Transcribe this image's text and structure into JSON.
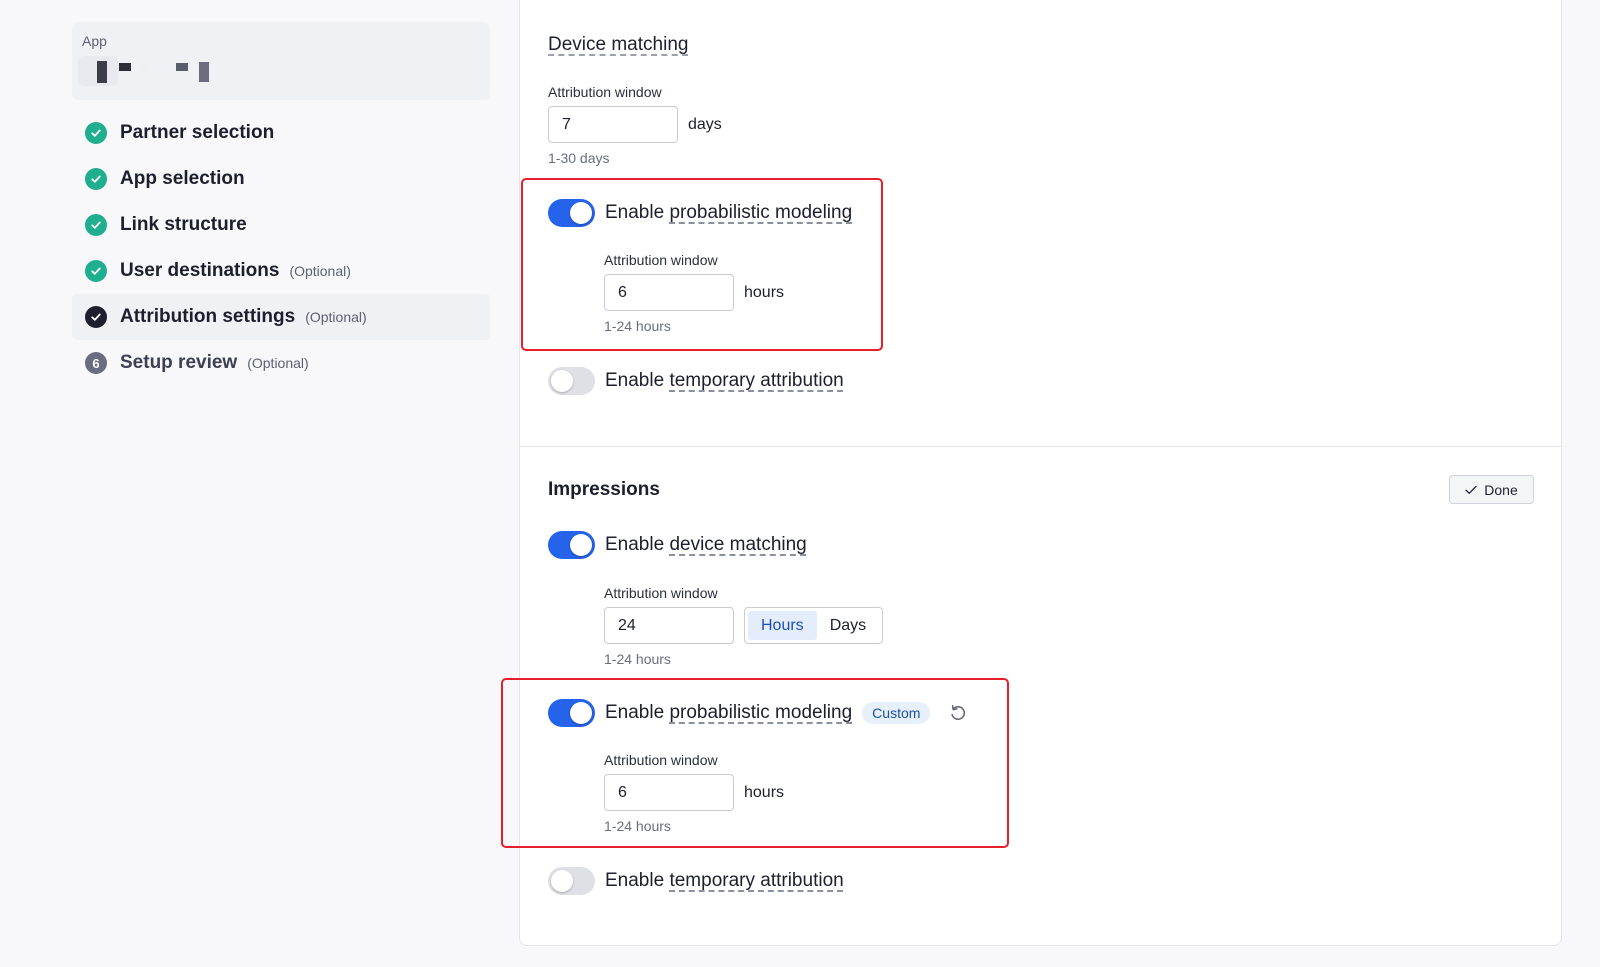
{
  "sidebar": {
    "app_label": "App",
    "steps": [
      {
        "label": "Partner selection",
        "optional": "",
        "status": "done"
      },
      {
        "label": "App selection",
        "optional": "",
        "status": "done"
      },
      {
        "label": "Link structure",
        "optional": "",
        "status": "done"
      },
      {
        "label": "User destinations",
        "optional": "(Optional)",
        "status": "done"
      },
      {
        "label": "Attribution settings",
        "optional": "(Optional)",
        "status": "current"
      },
      {
        "label": "Setup review",
        "optional": "(Optional)",
        "status": "pending",
        "number": "6"
      }
    ]
  },
  "clicks": {
    "device_matching_heading": "Device matching",
    "attr_window_label": "Attribution window",
    "attr_window_value": "7",
    "attr_window_unit": "days",
    "attr_window_hint": "1-30 days",
    "probabilistic": {
      "enabled": true,
      "prefix": "Enable ",
      "label": "probabilistic modeling",
      "window_label": "Attribution window",
      "window_value": "6",
      "window_unit": "hours",
      "window_hint": "1-24 hours"
    },
    "temporary": {
      "enabled": false,
      "prefix": "Enable ",
      "label": "temporary attribution"
    }
  },
  "impressions": {
    "title": "Impressions",
    "done_label": "Done",
    "device_matching": {
      "enabled": true,
      "prefix": "Enable ",
      "label": "device matching",
      "window_label": "Attribution window",
      "window_value": "24",
      "unit_options": [
        "Hours",
        "Days"
      ],
      "unit_selected": "Hours",
      "window_hint": "1-24 hours"
    },
    "probabilistic": {
      "enabled": true,
      "prefix": "Enable ",
      "label": "probabilistic modeling",
      "badge": "Custom",
      "window_label": "Attribution window",
      "window_value": "6",
      "window_unit": "hours",
      "window_hint": "1-24 hours"
    },
    "temporary": {
      "enabled": false,
      "prefix": "Enable ",
      "label": "temporary attribution"
    }
  },
  "colors": {
    "accent": "#2563eb",
    "success": "#1fae8e",
    "highlight": "#e5202a"
  }
}
